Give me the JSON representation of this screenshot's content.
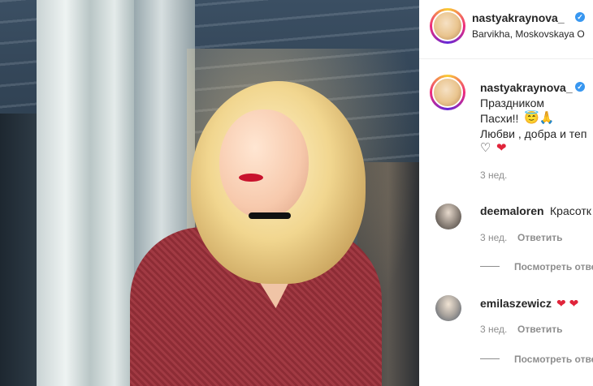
{
  "post": {
    "author": "nastyakraynova_",
    "location": "Barvikha, Moskovskaya O",
    "caption": {
      "author": "nastyakraynova_",
      "line1": "Праздником",
      "line2": "Пасхи!!",
      "line2_emoji": "😇🙏",
      "line3": "Любви , добра и теп",
      "hearts": [
        "♡",
        "❤"
      ],
      "time": "3 нед."
    },
    "comments": [
      {
        "username": "deemaloren",
        "text": "Красотк",
        "time": "3 нед.",
        "reply_label": "Ответить",
        "view_replies": "Посмотреть отве"
      },
      {
        "username": "emilaszewicz",
        "text": "❤ ❤",
        "time": "3 нед.",
        "reply_label": "Ответить",
        "view_replies": "Посмотреть отве"
      }
    ]
  },
  "icons": {
    "verified": "verified-badge-icon"
  },
  "colors": {
    "accent": "#3897f0",
    "heart": "#e0243a",
    "muted": "#8e8e8e",
    "text": "#262626"
  }
}
